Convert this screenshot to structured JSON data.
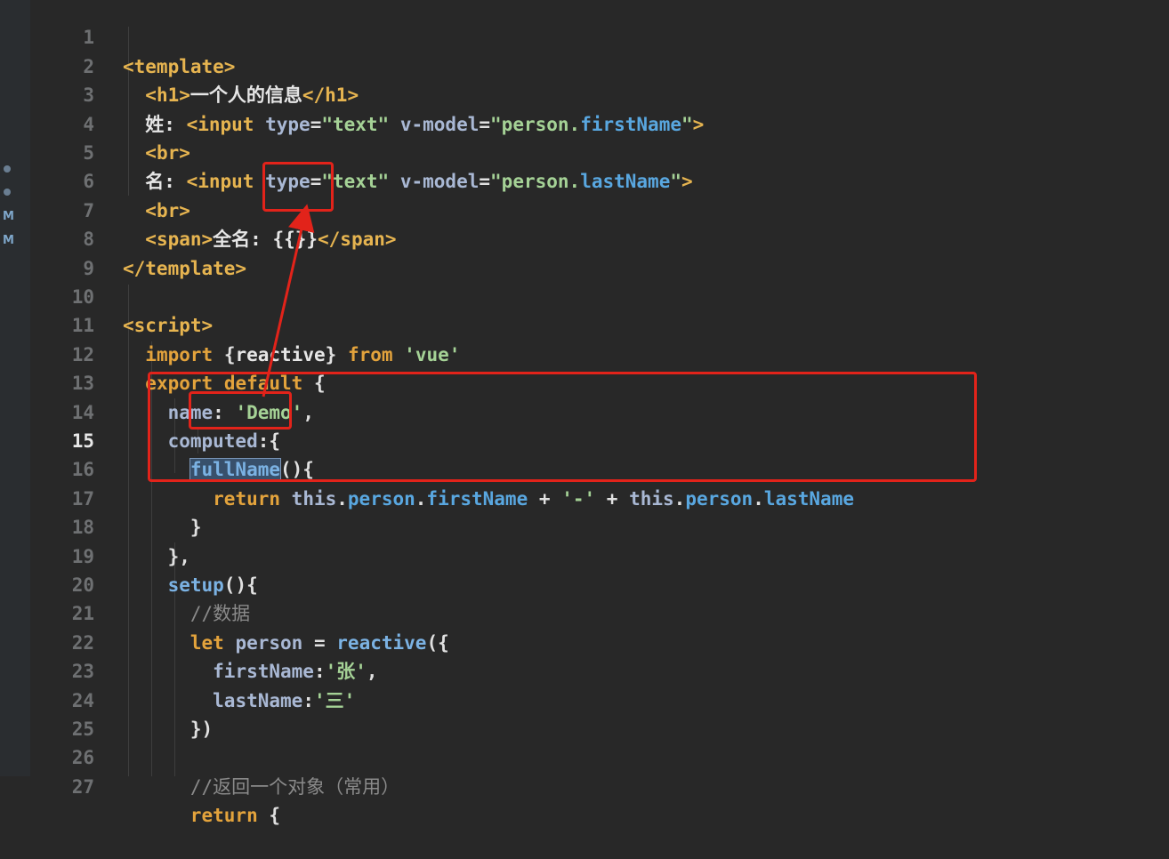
{
  "gutter": {
    "badges": [
      "M",
      "M"
    ]
  },
  "colors": {
    "annotation": "#e2231a",
    "background": "#282828"
  },
  "lines": [
    {
      "n": "1",
      "code": "<template>"
    },
    {
      "n": "2",
      "code": "  <h1>一个人的信息</h1>"
    },
    {
      "n": "3",
      "code": "  姓: <input type=\"text\" v-model=\"person.firstName\">"
    },
    {
      "n": "4",
      "code": "  <br>"
    },
    {
      "n": "5",
      "code": "  名: <input type=\"text\" v-model=\"person.lastName\">"
    },
    {
      "n": "6",
      "code": "  <br>"
    },
    {
      "n": "7",
      "code": "  <span>全名: {{}}</span>"
    },
    {
      "n": "8",
      "code": "</template>"
    },
    {
      "n": "9",
      "code": ""
    },
    {
      "n": "10",
      "code": "<script>"
    },
    {
      "n": "11",
      "code": "  import {reactive} from 'vue'"
    },
    {
      "n": "12",
      "code": "  export default {"
    },
    {
      "n": "13",
      "code": "    name: 'Demo',"
    },
    {
      "n": "14",
      "code": "    computed:{"
    },
    {
      "n": "15",
      "code": "      fullName(){"
    },
    {
      "n": "16",
      "code": "        return this.person.firstName + '-' + this.person.lastName"
    },
    {
      "n": "17",
      "code": "      }"
    },
    {
      "n": "18",
      "code": "    },"
    },
    {
      "n": "19",
      "code": "    setup(){"
    },
    {
      "n": "20",
      "code": "      //数据"
    },
    {
      "n": "21",
      "code": "      let person = reactive({"
    },
    {
      "n": "22",
      "code": "        firstName:'张',"
    },
    {
      "n": "23",
      "code": "        lastName:'三'"
    },
    {
      "n": "24",
      "code": "      })"
    },
    {
      "n": "25",
      "code": ""
    },
    {
      "n": "26",
      "code": "      //返回一个对象（常用）"
    },
    {
      "n": "27",
      "code": "      return {"
    }
  ],
  "active_line": "15"
}
